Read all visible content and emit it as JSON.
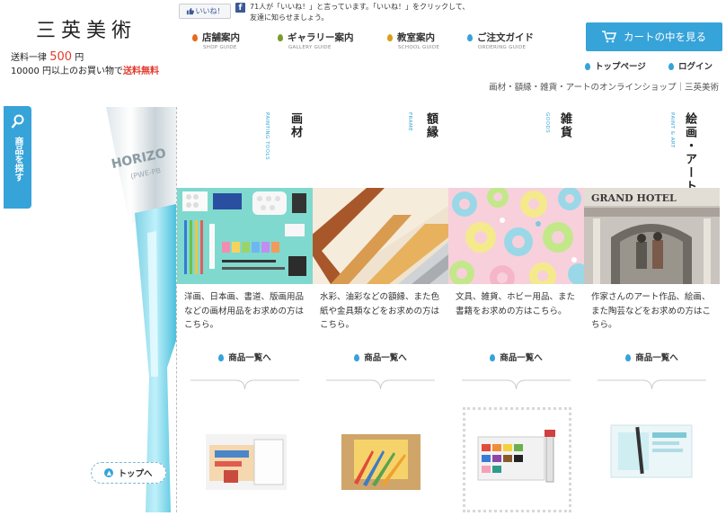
{
  "header": {
    "logo": "三英美術",
    "shipping_line1_pre": "送料一律 ",
    "shipping_price": "500",
    "shipping_line1_post": " 円",
    "shipping_line2_pre": "10000 円以上のお買い物で",
    "shipping_free": "送料無料",
    "like_button": "いいね！",
    "fb_text1": "71人が「いいね！」と言っています。「いいね！」をクリックして、",
    "fb_text2": "友達に知らせましょう。",
    "nav": [
      {
        "label": "店舗案内",
        "sub": "SHOP GUIDE",
        "color": "#e46a1f"
      },
      {
        "label": "ギャラリー案内",
        "sub": "GALLERY GUIDE",
        "color": "#7a9a2a"
      },
      {
        "label": "教室案内",
        "sub": "SCHOOL GUIDE",
        "color": "#d8a015"
      },
      {
        "label": "ご注文ガイド",
        "sub": "ORDERING GUIDE",
        "color": "#36a3d9"
      }
    ],
    "cart_button": "カートの中を見る",
    "top_page": "トップページ",
    "login": "ログイン",
    "tagline": "画材・額縁・雑貨・アートのオンラインショップ｜三英美術"
  },
  "sidebar": {
    "search_tab": "商品を探す",
    "top_button": "トップへ"
  },
  "categories": [
    {
      "title": "画材",
      "sub": "PAINTING TOOLS",
      "desc": "洋画、日本画、書道、版画用品などの画材用品をお求めの方はこちら。",
      "link": "商品一覧へ"
    },
    {
      "title": "額縁",
      "sub": "FRAME",
      "desc": "水彩、油彩などの額縁、また色紙や金具類などをお求めの方はこちら。",
      "link": "商品一覧へ"
    },
    {
      "title": "雑貨",
      "sub": "GOODS",
      "desc": "文具、雑貨、ホビー用品、また書籍をお求めの方はこちら。",
      "link": "商品一覧へ"
    },
    {
      "title": "絵画・アート",
      "sub": "PAINT & ART",
      "desc": "作家さんのアート作品、絵画、また陶芸などをお求めの方はこちら。",
      "link": "商品一覧へ"
    }
  ],
  "colors": {
    "accent": "#36a3d9",
    "price_red": "#e23b2e"
  },
  "icons": {
    "cart": "cart-icon",
    "search": "search-icon",
    "drop": "drop-icon",
    "facebook": "facebook-icon",
    "thumbs_up": "thumbs-up-icon"
  }
}
